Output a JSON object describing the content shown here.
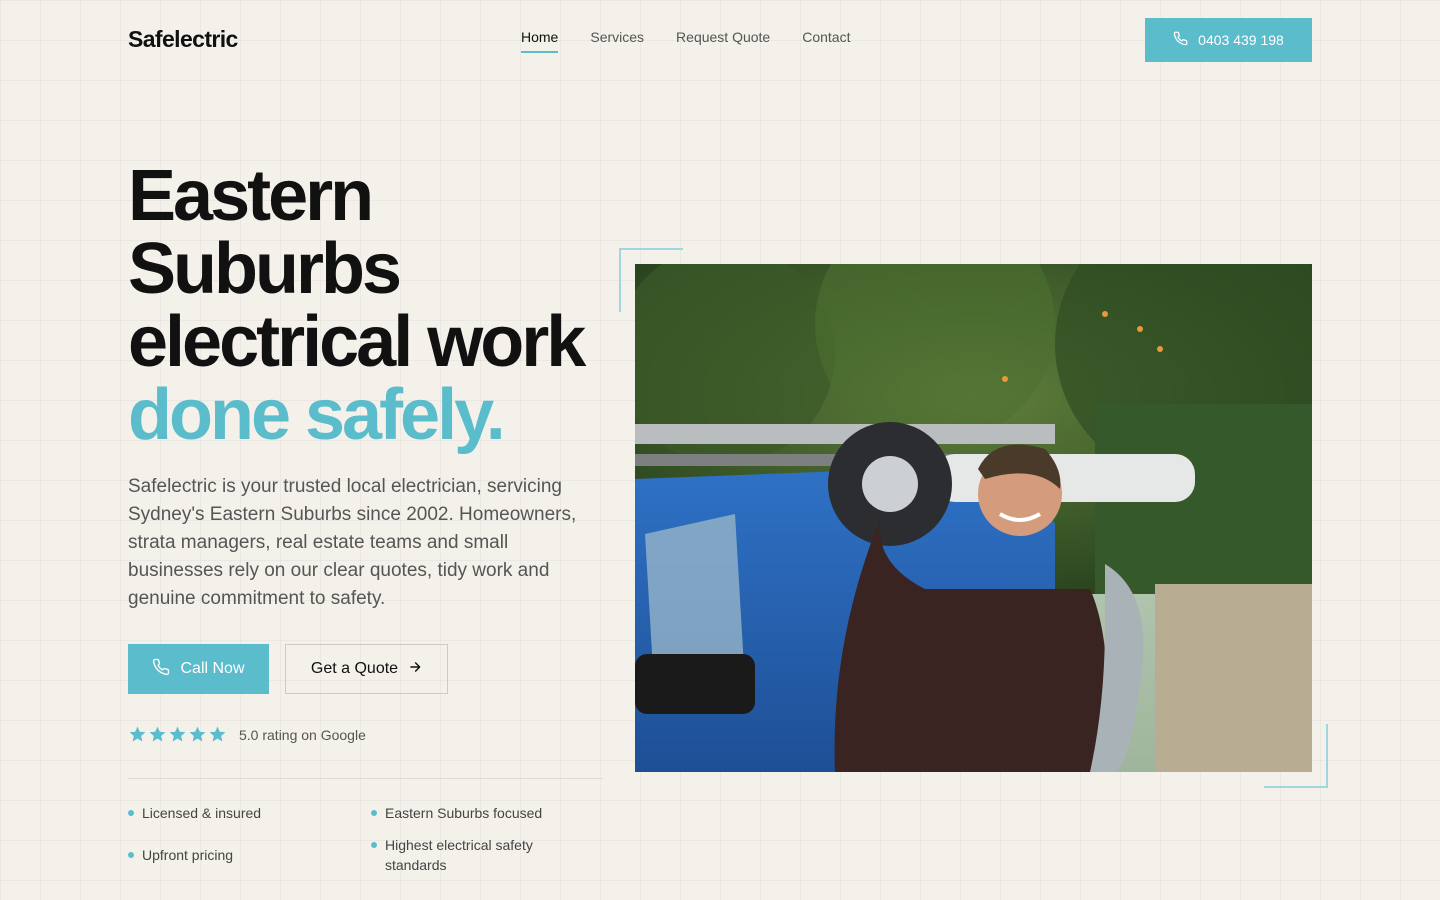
{
  "brand": {
    "logo": "Safelectric",
    "accent_color": "#5bbccc"
  },
  "nav": {
    "items": [
      {
        "label": "Home",
        "active": true
      },
      {
        "label": "Services",
        "active": false
      },
      {
        "label": "Request Quote",
        "active": false
      },
      {
        "label": "Contact",
        "active": false
      }
    ]
  },
  "header": {
    "phone_label": "0403 439 198",
    "phone_icon": "phone-icon"
  },
  "hero": {
    "title_line1": "Eastern",
    "title_line2": "Suburbs",
    "title_line3": "electrical work",
    "title_accent": "done safely.",
    "description": "Safelectric is your trusted local electrician, servicing Sydney's Eastern Suburbs since 2002. Homeowners, strata managers, real estate teams and small businesses rely on our clear quotes, tidy work and genuine commitment to safety.",
    "call_label": "Call Now",
    "quote_label": "Get a Quote"
  },
  "rating": {
    "stars": 5,
    "max": 5,
    "text": "5.0 rating on Google"
  },
  "features": [
    "Licensed & insured",
    "Eastern Suburbs focused",
    "Upfront pricing",
    "Highest electrical safety standards"
  ]
}
